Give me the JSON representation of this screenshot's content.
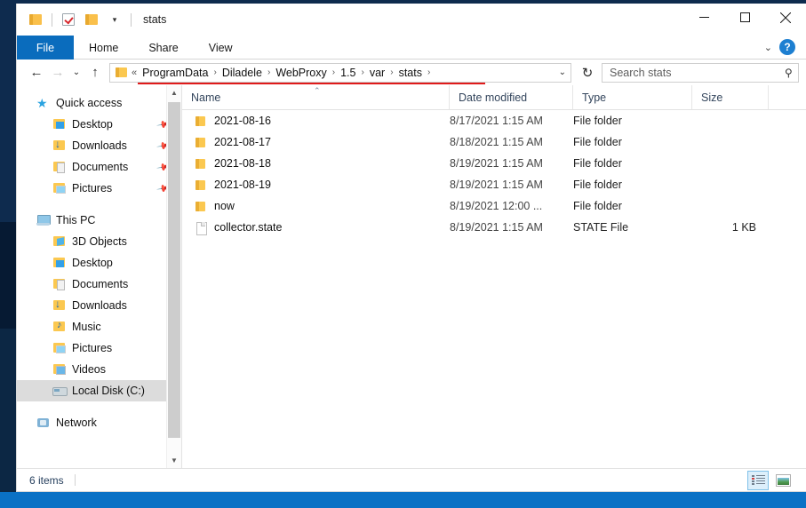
{
  "window": {
    "title": "stats",
    "quick_access_icons": [
      "folder-icon",
      "properties-checkbox-icon",
      "new-folder-icon"
    ],
    "qat_caret": "▾",
    "controls": {
      "minimize": "minimize-button",
      "maximize": "maximize-button",
      "close": "close-button"
    }
  },
  "ribbon": {
    "tabs": [
      {
        "label": "File",
        "active": true
      },
      {
        "label": "Home",
        "active": false
      },
      {
        "label": "Share",
        "active": false
      },
      {
        "label": "View",
        "active": false
      }
    ],
    "collapse_caret": "⌄",
    "help_label": "?"
  },
  "navigation": {
    "back": "←",
    "forward": "→",
    "recent": "⌄",
    "up": "↑",
    "refresh": "↻",
    "dropdown": "⌄"
  },
  "address": {
    "overflow": "«",
    "separator": "›",
    "crumbs": [
      "ProgramData",
      "Diladele",
      "WebProxy",
      "1.5",
      "var",
      "stats"
    ],
    "annotation_color": "#e01b1b"
  },
  "search": {
    "placeholder": "Search stats",
    "icon": "search-icon"
  },
  "sidebar": {
    "groups": [
      {
        "name": "Quick access",
        "icon": "star-icon",
        "items": [
          {
            "label": "Desktop",
            "icon": "desktop-folder-icon",
            "pinned": true
          },
          {
            "label": "Downloads",
            "icon": "downloads-folder-icon",
            "pinned": true
          },
          {
            "label": "Documents",
            "icon": "documents-folder-icon",
            "pinned": true
          },
          {
            "label": "Pictures",
            "icon": "pictures-folder-icon",
            "pinned": true
          }
        ]
      },
      {
        "name": "This PC",
        "icon": "this-pc-icon",
        "items": [
          {
            "label": "3D Objects",
            "icon": "3d-objects-icon",
            "pinned": false
          },
          {
            "label": "Desktop",
            "icon": "desktop-folder-icon",
            "pinned": false
          },
          {
            "label": "Documents",
            "icon": "documents-folder-icon",
            "pinned": false
          },
          {
            "label": "Downloads",
            "icon": "downloads-folder-icon",
            "pinned": false
          },
          {
            "label": "Music",
            "icon": "music-folder-icon",
            "pinned": false
          },
          {
            "label": "Pictures",
            "icon": "pictures-folder-icon",
            "pinned": false
          },
          {
            "label": "Videos",
            "icon": "videos-folder-icon",
            "pinned": false
          },
          {
            "label": "Local Disk (C:)",
            "icon": "disk-icon",
            "pinned": false,
            "selected": true
          }
        ]
      },
      {
        "name": "Network",
        "icon": "network-icon",
        "items": []
      }
    ],
    "pin_glyph": "📌"
  },
  "filelist": {
    "columns": [
      {
        "key": "name",
        "label": "Name"
      },
      {
        "key": "date",
        "label": "Date modified"
      },
      {
        "key": "type",
        "label": "Type"
      },
      {
        "key": "size",
        "label": "Size"
      }
    ],
    "sort_indicator": "⌃",
    "rows": [
      {
        "name": "2021-08-16",
        "date": "8/17/2021 1:15 AM",
        "type": "File folder",
        "size": "",
        "icon": "folder-icon"
      },
      {
        "name": "2021-08-17",
        "date": "8/18/2021 1:15 AM",
        "type": "File folder",
        "size": "",
        "icon": "folder-icon"
      },
      {
        "name": "2021-08-18",
        "date": "8/19/2021 1:15 AM",
        "type": "File folder",
        "size": "",
        "icon": "folder-icon"
      },
      {
        "name": "2021-08-19",
        "date": "8/19/2021 1:15 AM",
        "type": "File folder",
        "size": "",
        "icon": "folder-icon"
      },
      {
        "name": "now",
        "date": "8/19/2021 12:00 ...",
        "type": "File folder",
        "size": "",
        "icon": "folder-icon"
      },
      {
        "name": "collector.state",
        "date": "8/19/2021 1:15 AM",
        "type": "STATE File",
        "size": "1 KB",
        "icon": "file-icon"
      }
    ]
  },
  "statusbar": {
    "item_count": "6 items",
    "views": [
      {
        "name": "details-view",
        "active": true
      },
      {
        "name": "large-icons-view",
        "active": false
      }
    ]
  }
}
